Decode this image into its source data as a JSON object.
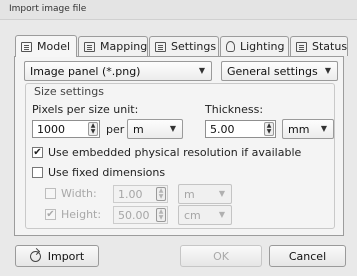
{
  "window": {
    "title": "Import image file"
  },
  "tabs": [
    {
      "label": "Model",
      "icon": "model-icon",
      "active": true
    },
    {
      "label": "Mapping",
      "icon": "mapping-icon"
    },
    {
      "label": "Settings",
      "icon": "settings-icon"
    },
    {
      "label": "Lighting",
      "icon": "lightbulb-icon"
    },
    {
      "label": "Status",
      "icon": "status-icon"
    }
  ],
  "panel": {
    "type_select": "Image panel (*.png)",
    "settings_select": "General settings",
    "size_group_title": "Size settings",
    "pixels_label": "Pixels per size unit:",
    "pixels_value": "1000",
    "per_label": "per",
    "pixels_unit": "m",
    "thickness_label": "Thickness:",
    "thickness_value": "5.00",
    "thickness_unit": "mm",
    "embedded_label": "Use embedded physical resolution if available",
    "embedded_checked": true,
    "fixed_label": "Use fixed dimensions",
    "fixed_checked": false,
    "width_label": "Width:",
    "width_value": "1.00",
    "width_unit": "m",
    "width_checked": false,
    "height_label": "Height:",
    "height_value": "50.00",
    "height_unit": "cm",
    "height_checked": true
  },
  "footer": {
    "import_label": "Import",
    "ok_label": "OK",
    "cancel_label": "Cancel"
  }
}
